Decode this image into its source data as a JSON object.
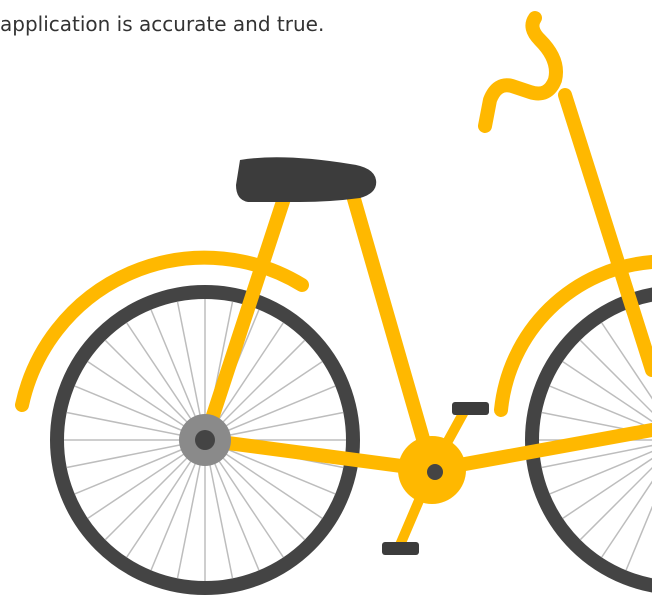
{
  "text": {
    "caption": "application is accurate and true."
  },
  "illustration": {
    "subject": "bicycle-illustration",
    "colors": {
      "frame": "#FFB800",
      "tire": "#444444",
      "spoke": "#BDBDBD",
      "hub": "#8A8A8A",
      "saddle": "#3C3C3C",
      "pedal": "#3C3C3C"
    }
  }
}
